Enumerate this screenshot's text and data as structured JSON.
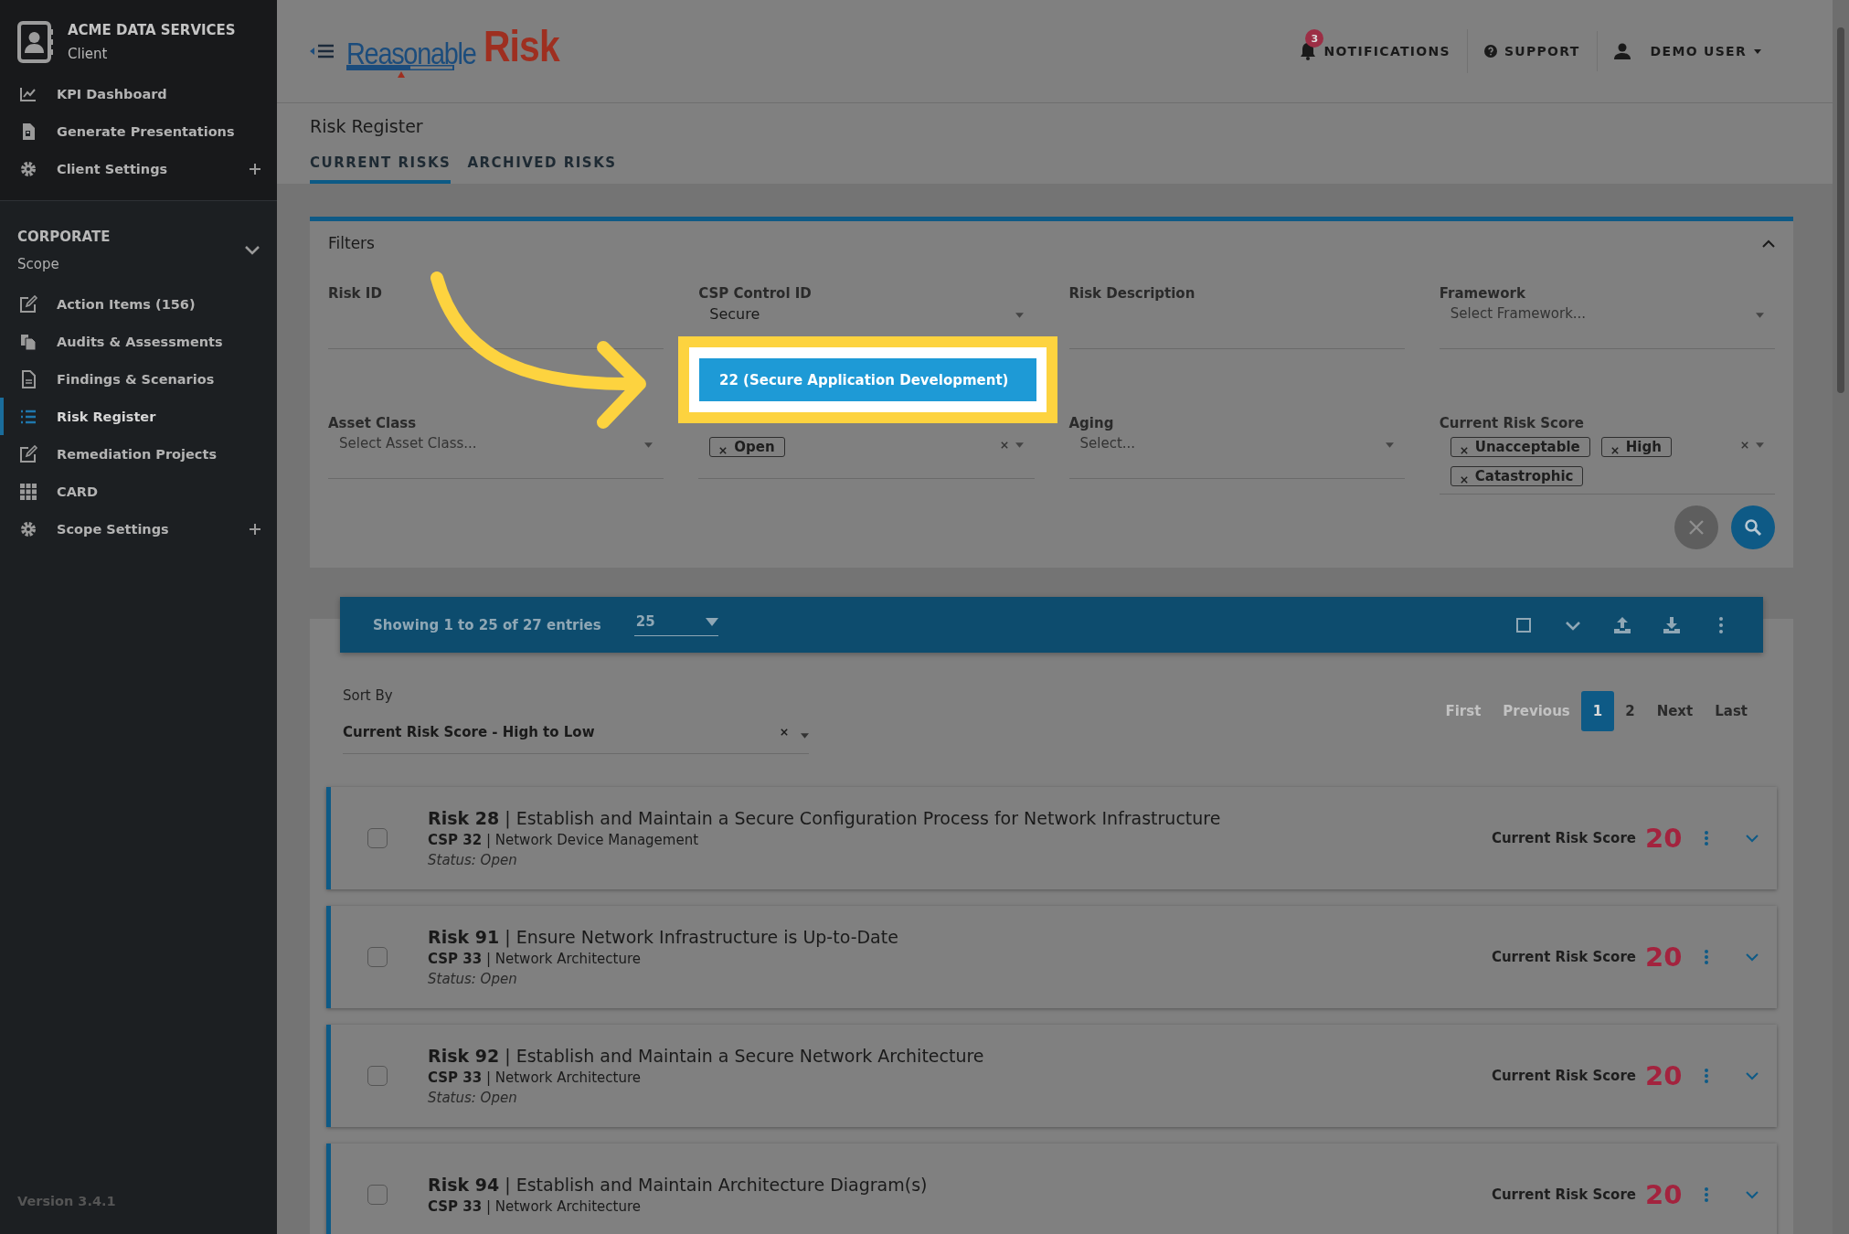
{
  "sidebar": {
    "client": {
      "name": "ACME DATA SERVICES",
      "subtitle": "Client"
    },
    "client_items": [
      {
        "label": "KPI Dashboard",
        "kind": "chart",
        "expandable": false,
        "selected": false
      },
      {
        "label": "Generate Presentations",
        "kind": "file",
        "expandable": false,
        "selected": false
      },
      {
        "label": "Client Settings",
        "kind": "gear",
        "expandable": true,
        "selected": false
      }
    ],
    "scope": {
      "name": "CORPORATE",
      "subtitle": "Scope",
      "expanded": true
    },
    "scope_items": [
      {
        "label": "Action Items (156)",
        "kind": "edit",
        "expandable": false,
        "selected": false
      },
      {
        "label": "Audits & Assessments",
        "kind": "copy",
        "expandable": false,
        "selected": false
      },
      {
        "label": "Findings & Scenarios",
        "kind": "doc",
        "expandable": false,
        "selected": false
      },
      {
        "label": "Risk Register",
        "kind": "list",
        "expandable": false,
        "selected": true
      },
      {
        "label": "Remediation Projects",
        "kind": "edit",
        "expandable": false,
        "selected": false
      },
      {
        "label": "CARD",
        "kind": "grid",
        "expandable": false,
        "selected": false
      },
      {
        "label": "Scope Settings",
        "kind": "gear",
        "expandable": true,
        "selected": false
      }
    ],
    "version": "Version 3.4.1"
  },
  "header": {
    "logo": {
      "first": "Reasonable",
      "second": "Risk"
    },
    "notifications": {
      "label": "NOTIFICATIONS",
      "badge": "3"
    },
    "support": "SUPPORT",
    "user": "DEMO USER"
  },
  "page": {
    "title": "Risk Register",
    "tabs": [
      {
        "label": "CURRENT RISKS",
        "selected": true
      },
      {
        "label": "ARCHIVED RISKS",
        "selected": false
      }
    ]
  },
  "filters": {
    "title": "Filters",
    "expanded": true,
    "fields": [
      {
        "label": "Risk ID",
        "kind": "text"
      },
      {
        "label": "CSP Control ID",
        "kind": "select",
        "value": "Secure"
      },
      {
        "label": "Risk Description",
        "kind": "text"
      },
      {
        "label": "Framework",
        "kind": "select",
        "placeholder": "Select Framework..."
      },
      {
        "label": "Asset Class",
        "kind": "select",
        "placeholder": "Select Asset Class..."
      },
      {
        "kind": "tags",
        "tags": [
          "Open"
        ]
      },
      {
        "label": "Aging",
        "kind": "select",
        "placeholder": "Select..."
      },
      {
        "label": "Current Risk Score",
        "kind": "tags",
        "tags": [
          "Unacceptable",
          "High",
          "Catastrophic"
        ]
      }
    ],
    "dropdown": {
      "options": [
        {
          "label": "22 (Secure Application Development)",
          "selected": true
        }
      ]
    }
  },
  "table": {
    "entries_info": "Showing 1 to 25 of 27 entries",
    "page_size": "25",
    "sort": {
      "label": "Sort By",
      "value": "Current Risk Score - High to Low"
    },
    "pagination": [
      {
        "label": "First",
        "selected": false,
        "disabled": true
      },
      {
        "label": "Previous",
        "selected": false,
        "disabled": true
      },
      {
        "label": "1",
        "selected": true,
        "disabled": false
      },
      {
        "label": "2",
        "selected": false,
        "disabled": false
      },
      {
        "label": "Next",
        "selected": false,
        "disabled": false
      },
      {
        "label": "Last",
        "selected": false,
        "disabled": false
      }
    ],
    "rows": [
      {
        "title": "**Risk 28** | Establish and Maintain a Secure Configuration Process for Network Infrastructure",
        "csp": "**CSP 32** | Network Device Management",
        "status": "Status: Open",
        "score_label": "Current Risk Score",
        "score": "20",
        "checked": false
      },
      {
        "title": "**Risk 91** | Ensure Network Infrastructure is Up-to-Date",
        "csp": "**CSP 33** | Network Architecture",
        "status": "Status: Open",
        "score_label": "Current Risk Score",
        "score": "20",
        "checked": false
      },
      {
        "title": "**Risk 92** | Establish and Maintain a Secure Network Architecture",
        "csp": "**CSP 33** | Network Architecture",
        "status": "Status: Open",
        "score_label": "Current Risk Score",
        "score": "20",
        "checked": false
      },
      {
        "title": "**Risk 94** | Establish and Maintain Architecture Diagram(s)",
        "csp": "**CSP 33** | Network Architecture",
        "score_label": "Current Risk Score",
        "score": "20",
        "checked": false
      }
    ]
  }
}
